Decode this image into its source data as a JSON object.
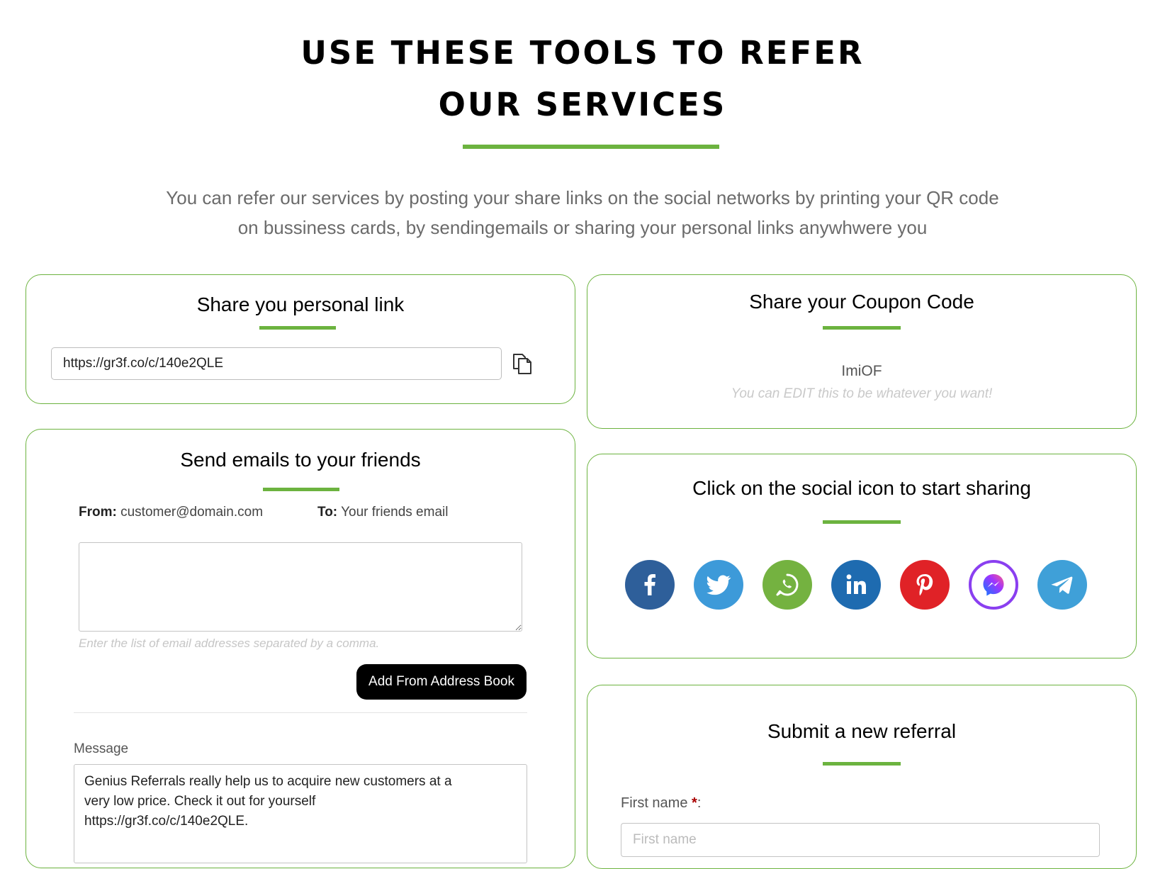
{
  "hero": {
    "title_line1": "USE THESE TOOLS TO REFER",
    "title_line2": "OUR SERVICES",
    "intro_line1": "You can refer our services by posting your share links on the social networks by printing your QR code",
    "intro_line2": "on bussiness cards, by sendingemails or sharing your personal links anywhwere you"
  },
  "link_card": {
    "title": "Share you personal link",
    "url": "https://gr3f.co/c/140e2QLE",
    "copy_icon": "copy-icon"
  },
  "coupon_card": {
    "title": "Share your Coupon Code",
    "code": "ImiOF",
    "hint": "You can EDIT this to be whatever you want!"
  },
  "email_card": {
    "title": "Send emails to your friends",
    "from_label": "From:",
    "from_value": "customer@domain.com",
    "to_label": "To:",
    "to_value": "Your friends email",
    "emails_hint": "Enter the list of email addresses separated by a comma.",
    "address_book_button": "Add From Address Book",
    "message_label": "Message",
    "message_value": "Genius Referrals really help us to acquire new customers at a\nvery low price. Check it out for yourself\nhttps://gr3f.co/c/140e2QLE."
  },
  "social_card": {
    "title": "Click on the social icon to start sharing",
    "networks": [
      {
        "icon": "facebook-icon",
        "color": "#2e5f9a"
      },
      {
        "icon": "twitter-icon",
        "color": "#3d9ad9"
      },
      {
        "icon": "whatsapp-icon",
        "color": "#74b240"
      },
      {
        "icon": "linkedin-icon",
        "color": "#1e6bb0"
      },
      {
        "icon": "pinterest-icon",
        "color": "#e02227"
      },
      {
        "icon": "messenger-icon",
        "color": "#8a3ff0"
      },
      {
        "icon": "telegram-icon",
        "color": "#3fa0d8"
      }
    ]
  },
  "referral_card": {
    "title": "Submit a new referral",
    "first_name_label": "First name",
    "required_mark": "*",
    "first_name_label_suffix": ":",
    "first_name_placeholder": "First name"
  },
  "colors": {
    "accent": "#6cb33f",
    "button_bg": "#000000"
  }
}
